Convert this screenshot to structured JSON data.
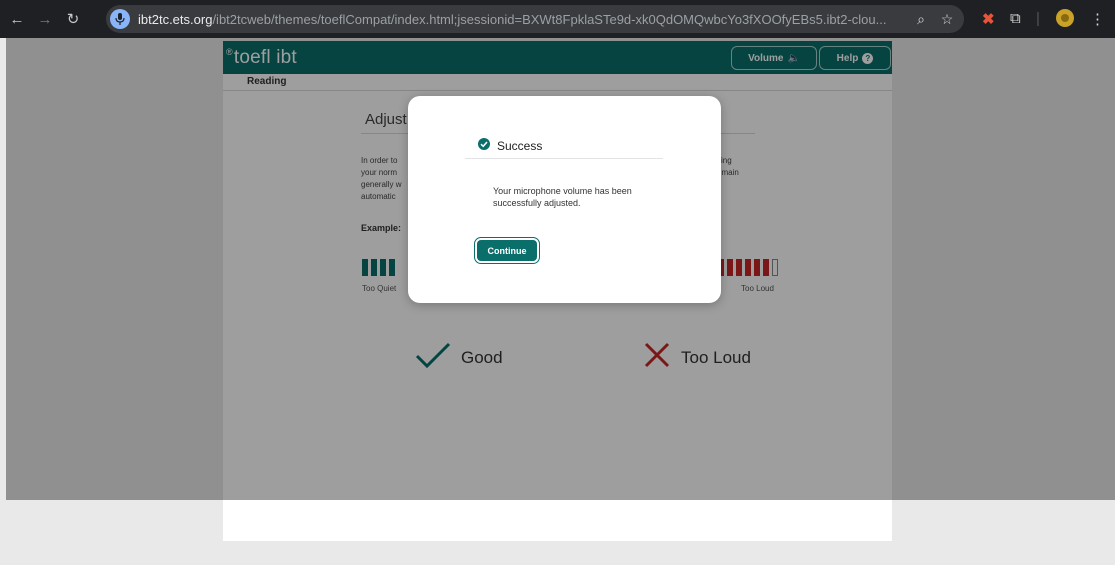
{
  "browser": {
    "url_host": "ibt2tc.ets.org",
    "url_path": "/ibt2tcweb/themes/toeflCompat/index.html;jsessionid=BXWt8FpklaSTe9d-xk0QdOMQwbcYo3fXOOfyEBs5.ibt2-clou..."
  },
  "app": {
    "logo": "toefl ibt",
    "logo_mark": "®",
    "volume_label": "Volume",
    "help_label": "Help",
    "section": "Reading"
  },
  "content": {
    "heading": "Adjust",
    "para_left": [
      "In order to",
      "your norm",
      "generally w",
      "automatic"
    ],
    "para_right": [
      "sing",
      "emain"
    ],
    "example_label": "Example:",
    "too_quiet": "Too Quiet",
    "too_loud": "Too Loud",
    "good_result": "Good",
    "too_loud_result": "Too Loud"
  },
  "modal": {
    "title": "Success",
    "message": "Your microphone volume has been successfully adjusted.",
    "continue_label": "Continue"
  },
  "colors": {
    "brand_teal": "#0a6e6b",
    "error_red": "#c62828"
  }
}
